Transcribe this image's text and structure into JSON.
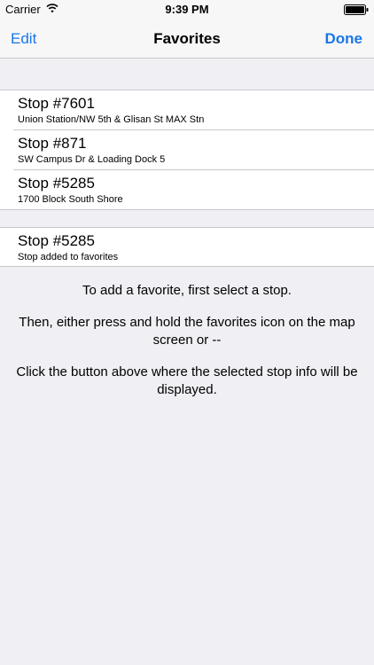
{
  "status_bar": {
    "carrier": "Carrier",
    "time": "9:39 PM",
    "wifi_icon": "wifi-icon",
    "battery_icon": "battery-icon"
  },
  "nav": {
    "edit_label": "Edit",
    "title": "Favorites",
    "done_label": "Done",
    "accent_color": "#1a75ea"
  },
  "favorites": [
    {
      "title": "Stop #7601",
      "subtitle": "Union Station/NW 5th & Glisan St MAX Stn"
    },
    {
      "title": "Stop #871",
      "subtitle": "SW Campus Dr & Loading Dock 5"
    },
    {
      "title": "Stop #5285",
      "subtitle": "1700 Block South Shore"
    }
  ],
  "current_stop": {
    "title": "Stop #5285",
    "subtitle": "Stop added to favorites"
  },
  "help": {
    "line1": "To add a favorite, first select a stop.",
    "line2": "Then, either press and hold the favorites icon on the map screen or --",
    "line3": "Click the button above where the selected stop info will be displayed."
  }
}
